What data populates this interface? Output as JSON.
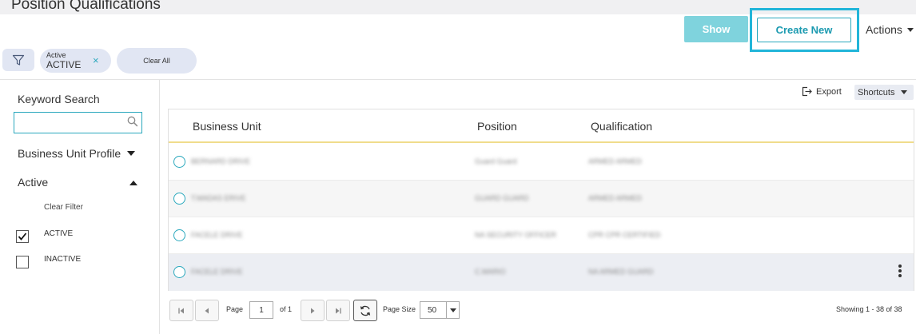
{
  "header": {
    "title": "Position Qualifications",
    "show_label": "Show",
    "create_new_label": "Create New",
    "actions_label": "Actions"
  },
  "filters": {
    "chip_label": "Active",
    "chip_value": "ACTIVE",
    "chip_remove": "×",
    "clear_all": "Clear All"
  },
  "sidebar": {
    "keyword_label": "Keyword Search",
    "keyword_value": "",
    "business_unit_profile": "Business Unit Profile",
    "active_header": "Active",
    "clear_filter": "Clear Filter",
    "options": [
      {
        "label": "ACTIVE",
        "checked": true
      },
      {
        "label": "INACTIVE",
        "checked": false
      }
    ]
  },
  "toolbar": {
    "export_label": "Export",
    "shortcuts_label": "Shortcuts"
  },
  "grid": {
    "columns": [
      "Business Unit",
      "Position",
      "Qualification"
    ],
    "rows": [
      {
        "business_unit": "BERNARD DRIVE",
        "position": "Guard Guard",
        "qualification": "ARMED ARMED"
      },
      {
        "business_unit": "T.MADAS ERIVE",
        "position": "GUARD GUARD",
        "qualification": "ARMED ARMED"
      },
      {
        "business_unit": "FACELE DRIVE",
        "position": "NA SECURITY OFFICER",
        "qualification": "CPR CPR CERTIFIED"
      },
      {
        "business_unit": "FACELE DRIVE",
        "position": "C.MARIO",
        "qualification": "NA ARMED GUARD"
      }
    ]
  },
  "pager": {
    "page_label": "Page",
    "page_value": "1",
    "of_label": "of 1",
    "page_size_label": "Page Size",
    "page_size_value": "50",
    "showing": "Showing 1 - 38 of 38"
  },
  "colors": {
    "accent": "#2aa8bd",
    "show_button": "#7fd3dd",
    "highlight_border": "#21b5d9",
    "chip_bg": "#e1e6f3",
    "header_underline": "#f0dc8c"
  }
}
